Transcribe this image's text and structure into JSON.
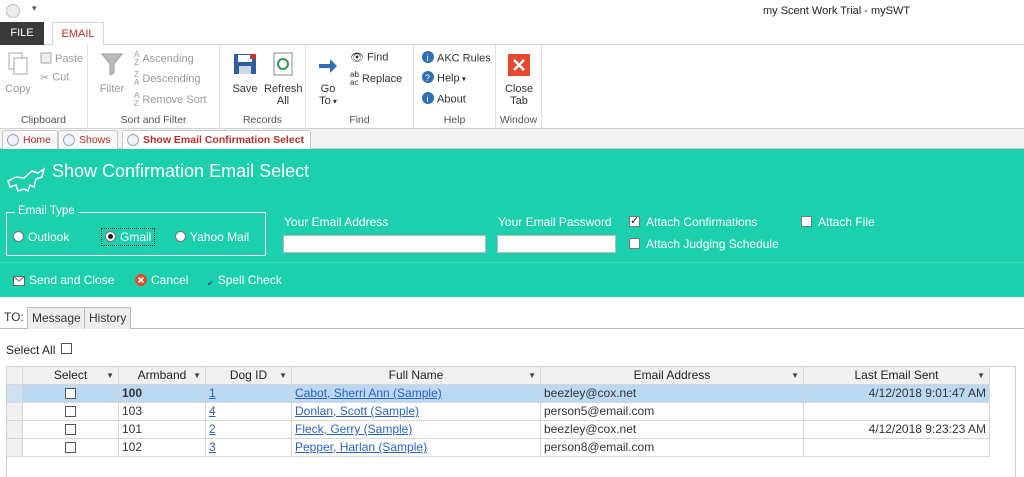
{
  "window": {
    "title": "my Scent Work Trial - mySWT"
  },
  "ribbon_tabs": {
    "file": "FILE",
    "email": "EMAIL"
  },
  "ribbon": {
    "clipboard": {
      "label": "Clipboard",
      "copy": "Copy",
      "paste": "Paste",
      "cut": "Cut"
    },
    "sort_filter": {
      "label": "Sort and Filter",
      "filter": "Filter",
      "ascending": "Ascending",
      "descending": "Descending",
      "remove_sort": "Remove Sort"
    },
    "records": {
      "label": "Records",
      "save": "Save",
      "refresh_line1": "Refresh",
      "refresh_line2": "All"
    },
    "find": {
      "label": "Find",
      "goto_line1": "Go",
      "goto_line2": "To",
      "find": "Find",
      "replace": "Replace"
    },
    "help": {
      "label": "Help",
      "akc_rules": "AKC Rules",
      "help": "Help",
      "about": "About"
    },
    "window": {
      "label": "Window",
      "close_line1": "Close",
      "close_line2": "Tab"
    }
  },
  "doc_tabs": [
    "Home",
    "Shows",
    "Show Email Confirmation Select"
  ],
  "form": {
    "title": "Show Confirmation Email Select",
    "email_type": {
      "legend": "Email Type",
      "options": [
        "Outlook",
        "Gmail",
        "Yahoo Mail"
      ],
      "selected": "Gmail"
    },
    "email_address_label": "Your Email Address",
    "email_address_value": "",
    "email_password_label": "Your Email Password",
    "email_password_value": "",
    "attach_confirmations": {
      "label": "Attach Confirmations",
      "checked": true
    },
    "attach_judging": {
      "label": "Attach Judging Schedule",
      "checked": false
    },
    "attach_file": {
      "label": "Attach File",
      "checked": false
    },
    "actions": {
      "send": "Send and Close",
      "cancel": "Cancel",
      "spell": "Spell Check"
    }
  },
  "subtabs": {
    "to": "TO:",
    "message": "Message",
    "history": "History"
  },
  "select_all": {
    "label": "Select All",
    "checked": false
  },
  "table": {
    "columns": [
      "Select",
      "Armband",
      "Dog ID",
      "Full Name",
      "Email Address",
      "Last Email Sent"
    ],
    "rows": [
      {
        "select": false,
        "armband": "100",
        "dog_id": "1",
        "full_name": " Cabot, Sherri Ann (Sample)",
        "email": "beezley@cox.net",
        "last_sent": "4/12/2018 9:01:47 AM"
      },
      {
        "select": false,
        "armband": "103",
        "dog_id": "4",
        "full_name": " Donlan, Scott (Sample)",
        "email": "person5@email.com",
        "last_sent": ""
      },
      {
        "select": false,
        "armband": "101",
        "dog_id": "2",
        "full_name": " Fleck, Gerry (Sample)",
        "email": "beezley@cox.net",
        "last_sent": "4/12/2018 9:23:23 AM"
      },
      {
        "select": false,
        "armband": "102",
        "dog_id": "3",
        "full_name": " Pepper, Harlan (Sample)",
        "email": "person8@email.com",
        "last_sent": ""
      }
    ]
  },
  "colors": {
    "accent_teal": "#1dd0ad",
    "tab_red": "#b8302a",
    "link_blue": "#2a62c7",
    "selected_row": "#bcd9f3"
  }
}
